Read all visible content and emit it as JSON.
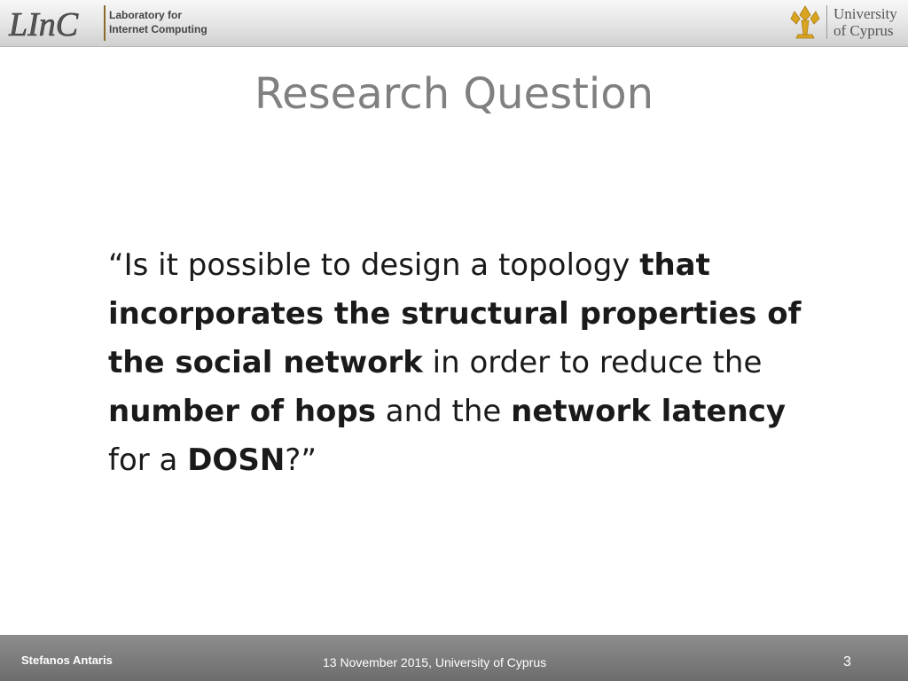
{
  "header": {
    "lab_logo": {
      "text": "LInC",
      "icon": "linc-logo-icon",
      "color": "#4a4a4a",
      "accent": "#8a6a2a"
    },
    "lab_name_line1": "Laboratory for",
    "lab_name_line2": "Internet Computing",
    "university_emblem": {
      "icon": "university-emblem-icon",
      "color": "#d9a520"
    },
    "university_name_line1": "University",
    "university_name_line2": "of Cyprus"
  },
  "slide": {
    "title": "Research Question",
    "quote_segments": [
      {
        "text": "“Is it possible to design a topology ",
        "bold": false
      },
      {
        "text": "that incorporates the structural properties of the social network",
        "bold": true
      },
      {
        "text": " in order to reduce the ",
        "bold": false
      },
      {
        "text": "number of hops",
        "bold": true
      },
      {
        "text": " and the ",
        "bold": false
      },
      {
        "text": "network latency",
        "bold": true
      },
      {
        "text": " for a ",
        "bold": false
      },
      {
        "text": "DOSN",
        "bold": true
      },
      {
        "text": "?”",
        "bold": false
      }
    ]
  },
  "footer": {
    "author": "Stefanos Antaris",
    "date_place": "13 November 2015, University of Cyprus",
    "page_number": "3"
  }
}
